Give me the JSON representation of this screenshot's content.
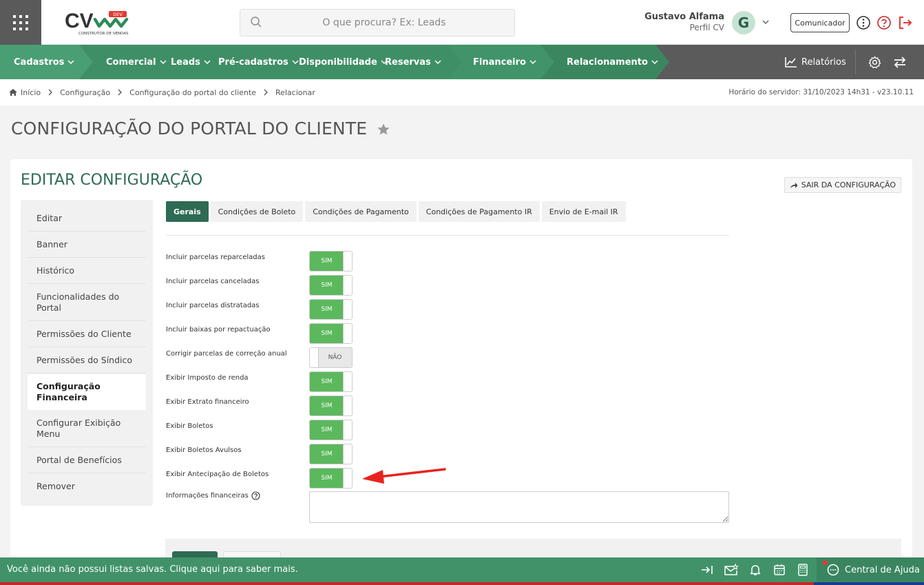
{
  "header": {
    "logo_text": "CV",
    "logo_badge": "DEV",
    "logo_sub": "CONSTRUTOR DE VENDAS",
    "search_placeholder": "O que procura? Ex: Leads",
    "user_name": "Gustavo Alfama",
    "user_profile": "Perfil CV",
    "avatar_letter": "G",
    "comunicador_label": "Comunicador"
  },
  "nav": {
    "items": [
      {
        "label": "Cadastros"
      },
      {
        "label": "Comercial"
      },
      {
        "label": "Leads"
      },
      {
        "label": "Pré-cadastros"
      },
      {
        "label": "Disponibilidade"
      },
      {
        "label": "Reservas"
      },
      {
        "label": "Financeiro"
      },
      {
        "label": "Relacionamento"
      }
    ],
    "reports_label": "Relatórios"
  },
  "breadcrumb": {
    "items": [
      "Início",
      "Configuração",
      "Configuração do portal do cliente",
      "Relacionar"
    ],
    "server_time": "Horário do servidor: 31/10/2023 14h31 - v23.10.11"
  },
  "page": {
    "title": "CONFIGURAÇÃO DO PORTAL DO CLIENTE"
  },
  "card": {
    "title": "EDITAR CONFIGURAÇÃO",
    "exit_label": "SAIR DA CONFIGURAÇÃO",
    "menu": [
      "Editar",
      "Banner",
      "Histórico",
      "Funcionalidades do Portal",
      "Permissões do Cliente",
      "Permissões do Síndico",
      "Configuração Financeira",
      "Configurar Exibição Menu",
      "Portal de Benefícios",
      "Remover"
    ],
    "tabs": [
      "Gerais",
      "Condições de Boleto",
      "Condições de Pagamento",
      "Condições de Pagamento IR",
      "Envio de E-mail IR"
    ],
    "fields": [
      {
        "label": "Incluir parcelas reparceladas",
        "value": "SIM",
        "on": true
      },
      {
        "label": "Incluir parcelas canceladas",
        "value": "SIM",
        "on": true
      },
      {
        "label": "Incluir parcelas distratadas",
        "value": "SIM",
        "on": true
      },
      {
        "label": "Incluir baixas por repactuação",
        "value": "SIM",
        "on": true
      },
      {
        "label": "Corrigir parcelas de correção anual",
        "value": "NÃO",
        "on": false
      },
      {
        "label": "Exibir Imposto de renda",
        "value": "SIM",
        "on": true
      },
      {
        "label": "Exibir Extrato financeiro",
        "value": "SIM",
        "on": true
      },
      {
        "label": "Exibir Boletos",
        "value": "SIM",
        "on": true
      },
      {
        "label": "Exibir Boletos Avulsos",
        "value": "SIM",
        "on": true
      },
      {
        "label": "Exibir Antecipação de Boletos",
        "value": "SIM",
        "on": true
      }
    ],
    "fin_info_label": "Informações financeiras",
    "fin_info_value": ""
  },
  "bottombar": {
    "message": "Você ainda não possui listas salvas. Clique aqui para saber mais.",
    "help_label": "Central de Ajuda"
  },
  "colors": {
    "primary_green": "#2e6b54",
    "nav_green": "#419269",
    "toggle_on": "#5cb85c",
    "nav_gray": "#5b5b5b",
    "annotation_red": "#e8231f"
  }
}
